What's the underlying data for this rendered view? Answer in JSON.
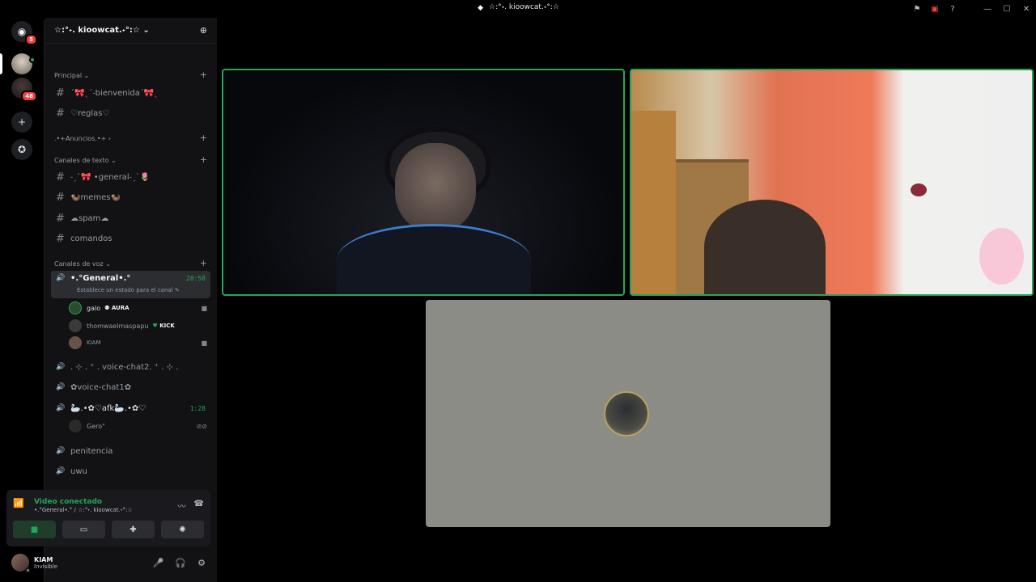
{
  "window": {
    "title": "☆:°˖. kioowcat.˖°:☆"
  },
  "guilds": {
    "badges": [
      "5",
      "48"
    ]
  },
  "server": {
    "name": "☆:°˖. kioowcat.˖°:☆"
  },
  "categories": {
    "principal": "Principal",
    "anuncios": ".•+Anuncios.•+",
    "texto": "Canales de texto",
    "voz": "Canales de voz"
  },
  "text_channels": [
    "ˊ🎀ˎˊ˗bienvenidaˊ🎀ˎ",
    "♡reglas♡",
    "˗ˏˋ🎀 •general˗ˏˋ🌷",
    "🦦memes🦦",
    "☁spam☁",
    "comandos"
  ],
  "voice": {
    "active_channel": "•.°General•.°",
    "active_timer": "28:58",
    "active_status": "Establece un estado para el canal",
    "users": [
      {
        "name": "galo",
        "tag": "AURA"
      },
      {
        "name": "thomwaelmaspapu",
        "tag": "KICK"
      },
      {
        "name": "KIAM",
        "tag": ""
      }
    ],
    "channels": [
      ". ⊹ . ⁺ . voice-chat2. ⁺ . ⊹ .",
      "✿voice-chat1✿",
      "🦢.•✿♡afk🦢.•✿♡",
      "penitencia",
      "uwu"
    ],
    "afk_timer": "1:28",
    "afk_user": "Gero\""
  },
  "voice_panel": {
    "status": "Video conectado",
    "sub": "•.°General•.° / ☆:°˖. kioowcat.˖°:☆"
  },
  "user_panel": {
    "name": "KIAM",
    "status": "Invisible"
  }
}
